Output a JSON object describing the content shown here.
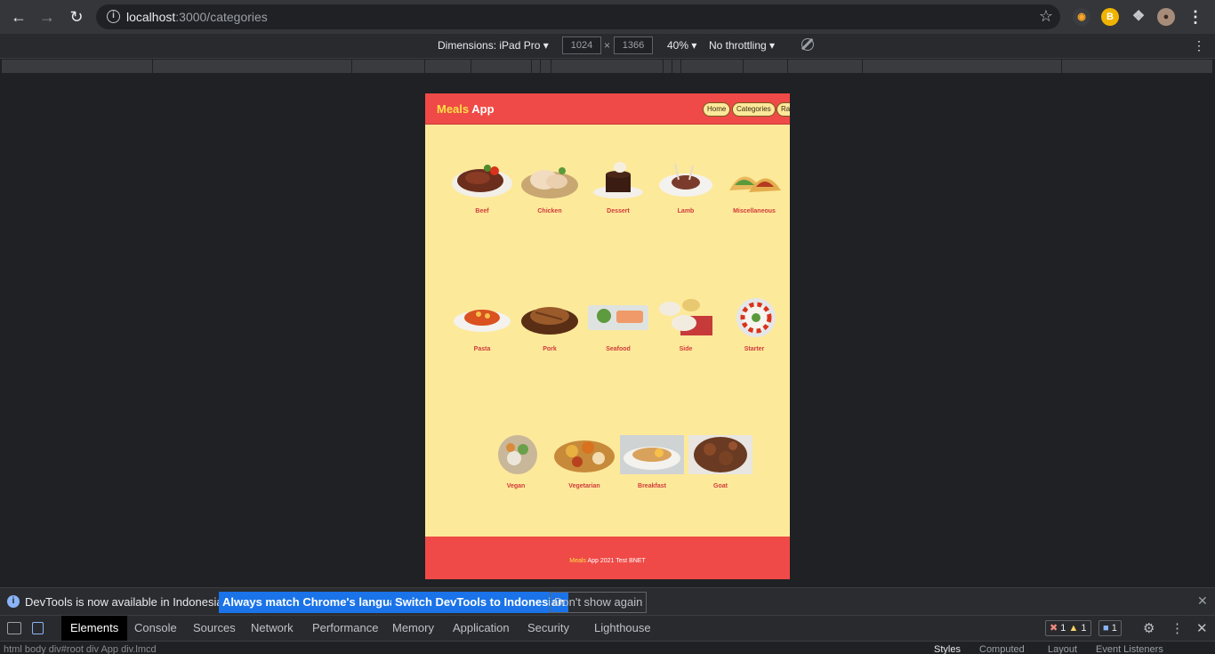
{
  "browser": {
    "url_host": "localhost",
    "url_rest": ":3000/categories"
  },
  "device_toolbar": {
    "dimensions_label": "Dimensions: iPad Pro",
    "width": "1024",
    "height": "1366",
    "zoom": "40%",
    "throttling": "No throttling"
  },
  "app": {
    "brand_meals": "Meals",
    "brand_app": "App",
    "nav": [
      "Home",
      "Categories",
      "Ran"
    ],
    "categories": [
      {
        "name": "Beef"
      },
      {
        "name": "Chicken"
      },
      {
        "name": "Dessert"
      },
      {
        "name": "Lamb"
      },
      {
        "name": "Miscellaneous"
      },
      {
        "name": "Pasta"
      },
      {
        "name": "Pork"
      },
      {
        "name": "Seafood"
      },
      {
        "name": "Side"
      },
      {
        "name": "Starter"
      },
      {
        "name": "Vegan"
      },
      {
        "name": "Vegetarian"
      },
      {
        "name": "Breakfast"
      },
      {
        "name": "Goat"
      }
    ],
    "footer_meals": "Meals",
    "footer_rest": "App 2021 Test BNET"
  },
  "notification": {
    "message": "DevTools is now available in Indonesian!",
    "btn_match": "Always match Chrome's language",
    "btn_switch": "Switch DevTools to Indonesian",
    "btn_dismiss": "Don't show again"
  },
  "devtools": {
    "tabs": [
      "Elements",
      "Console",
      "Sources",
      "Network",
      "Performance",
      "Memory",
      "Application",
      "Security",
      "Lighthouse"
    ],
    "errors": "1",
    "warnings": "1",
    "messages": "1",
    "breadcrumb": "html body div#root div App div.lmcd",
    "side_tabs": [
      "Styles",
      "Computed",
      "Layout",
      "Event Listeners"
    ]
  },
  "colors": {
    "header_red": "#ef4a47",
    "app_bg": "#fde99a",
    "brand_yellow": "#fde047",
    "label_red": "#d13b3b",
    "devtools_blue": "#1a73e8"
  }
}
